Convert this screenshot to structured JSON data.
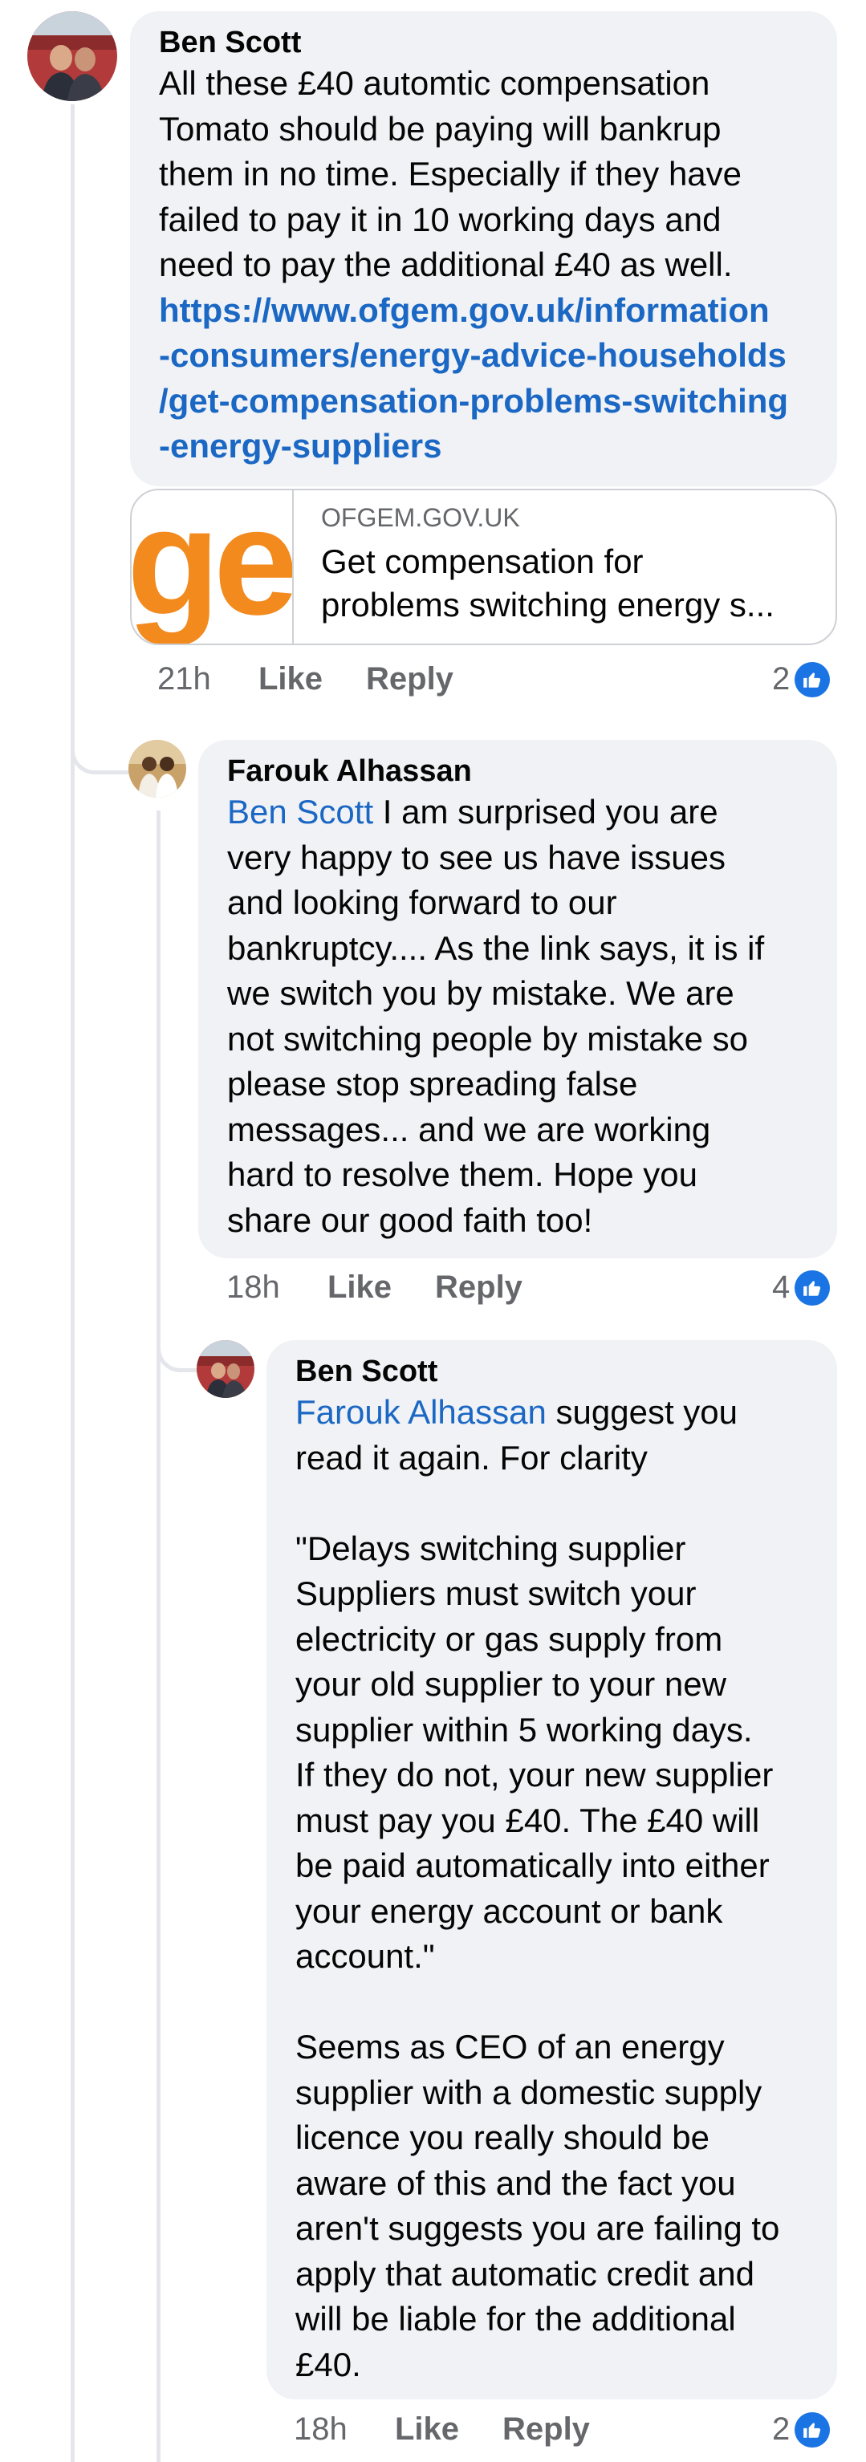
{
  "comments": [
    {
      "author": "Ben Scott",
      "text": "All these £40 automtic compensation\nTomato should be paying will bankrup\nthem in no time. Especially if they have\nfailed to pay it in 10 working days and\nneed to pay the additional £40 as well.",
      "link": "https://www.ofgem.gov.uk/information\n-consumers/energy-advice-households\n/get-compensation-problems-switching\n-energy-suppliers",
      "preview": {
        "logo_text": "ge",
        "domain": "OFGEM.GOV.UK",
        "title": "Get compensation for\nproblems switching energy s..."
      },
      "time": "21h",
      "like": "Like",
      "reply": "Reply",
      "reactions": "2"
    },
    {
      "author": "Farouk Alhassan",
      "mention": "Ben Scott",
      "text": " I am surprised you are\nvery happy to see us have issues\nand looking forward to our\nbankruptcy.... As the link says, it is if\nwe switch you by mistake. We are\nnot switching people by mistake so\nplease stop spreading false\nmessages... and we are working\nhard to resolve them. Hope you\nshare our good faith too!",
      "time": "18h",
      "like": "Like",
      "reply": "Reply",
      "reactions": "4"
    },
    {
      "author": "Ben Scott",
      "mention": "Farouk Alhassan",
      "text": " suggest you\nread it again. For clarity\n\n\"Delays switching supplier\nSuppliers must switch your\nelectricity or gas supply from\nyour old supplier to your new\nsupplier within 5 working days.\nIf they do not, your new supplier\nmust pay you £40. The £40 will\nbe paid automatically into either\nyour energy account or bank\naccount.\"\n\nSeems as CEO of an energy\nsupplier with a domestic supply\nlicence you really should be\naware of this and the fact you\naren't suggests you are failing to\napply that automatic credit and\nwill be liable for the additional\n£40.",
      "time": "18h",
      "like": "Like",
      "reply": "Reply",
      "reactions": "2"
    }
  ],
  "colors": {
    "bubble": "#f0f2f5",
    "mention": "#1b67c4",
    "meta": "#65676b",
    "like_badge": "#1b74e4",
    "ofgem_orange": "#f28a1e"
  },
  "icons": [
    "avatar-ben-scott",
    "avatar-farouk-alhassan",
    "ofgem-logo",
    "like-reaction-icon"
  ]
}
